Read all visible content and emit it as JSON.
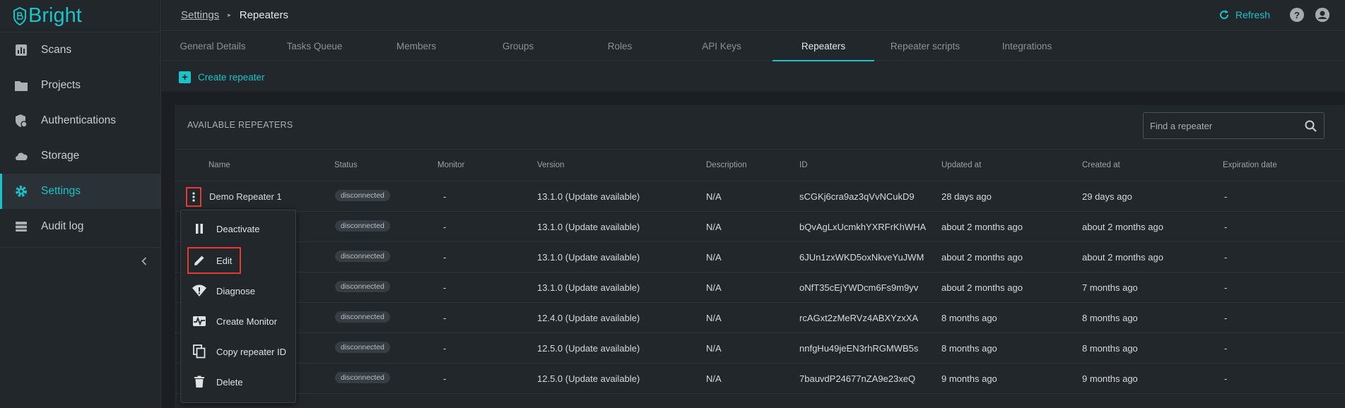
{
  "brand": {
    "name": "Bright",
    "color": "#19c3c8"
  },
  "sidebar": {
    "items": [
      {
        "label": "Scans",
        "icon": "scans-chart-icon"
      },
      {
        "label": "Projects",
        "icon": "folder-icon"
      },
      {
        "label": "Authentications",
        "icon": "shield-lock-icon"
      },
      {
        "label": "Storage",
        "icon": "cloud-icon"
      },
      {
        "label": "Settings",
        "icon": "gear-icon",
        "active": true
      },
      {
        "label": "Audit log",
        "icon": "audit-log-icon"
      }
    ]
  },
  "header": {
    "breadcrumb_parent": "Settings",
    "breadcrumb_current": "Repeaters",
    "refresh_label": "Refresh"
  },
  "tabs": [
    {
      "label": "General Details"
    },
    {
      "label": "Tasks Queue"
    },
    {
      "label": "Members"
    },
    {
      "label": "Groups"
    },
    {
      "label": "Roles"
    },
    {
      "label": "API Keys"
    },
    {
      "label": "Repeaters",
      "active": true
    },
    {
      "label": "Repeater scripts"
    },
    {
      "label": "Integrations"
    }
  ],
  "actions": {
    "create_label": "Create repeater"
  },
  "panel": {
    "title": "AVAILABLE REPEATERS",
    "search_placeholder": "Find a repeater"
  },
  "table": {
    "headers": [
      "Name",
      "Status",
      "Monitor",
      "Version",
      "Description",
      "ID",
      "Updated at",
      "Created at",
      "Expiration date"
    ],
    "rows": [
      {
        "name": "Demo Repeater 1",
        "status": "disconnected",
        "monitor": "-",
        "version": "13.1.0 (Update available)",
        "description": "N/A",
        "id": "sCGKj6cra9az3qVvNCukD9",
        "updated": "28 days ago",
        "created": "29 days ago",
        "expiration": "-"
      },
      {
        "name": "",
        "status": "disconnected",
        "monitor": "-",
        "version": "13.1.0 (Update available)",
        "description": "N/A",
        "id": "bQvAgLxUcmkhYXRFrKhWHA",
        "updated": "about 2 months ago",
        "created": "about 2 months ago",
        "expiration": "-"
      },
      {
        "name": "",
        "status": "disconnected",
        "monitor": "-",
        "version": "13.1.0 (Update available)",
        "description": "N/A",
        "id": "6JUn1zxWKD5oxNkveYuJWM",
        "updated": "about 2 months ago",
        "created": "about 2 months ago",
        "expiration": "-"
      },
      {
        "name": "",
        "status": "disconnected",
        "monitor": "-",
        "version": "13.1.0 (Update available)",
        "description": "N/A",
        "id": "oNfT35cEjYWDcm6Fs9m9yv",
        "updated": "about 2 months ago",
        "created": "7 months ago",
        "expiration": "-"
      },
      {
        "name": "",
        "status": "disconnected",
        "monitor": "-",
        "version": "12.4.0 (Update available)",
        "description": "N/A",
        "id": "rcAGxt2zMeRVz4ABXYzxXA",
        "updated": "8 months ago",
        "created": "8 months ago",
        "expiration": "-"
      },
      {
        "name": "",
        "status": "disconnected",
        "monitor": "-",
        "version": "12.5.0 (Update available)",
        "description": "N/A",
        "id": "nnfgHu49jeEN3rhRGMWB5s",
        "updated": "8 months ago",
        "created": "8 months ago",
        "expiration": "-"
      },
      {
        "name": "",
        "status": "disconnected",
        "monitor": "-",
        "version": "12.5.0 (Update available)",
        "description": "N/A",
        "id": "7bauvdP24677nZA9e23xeQ",
        "updated": "9 months ago",
        "created": "9 months ago",
        "expiration": "-"
      }
    ]
  },
  "context_menu": {
    "items": [
      {
        "label": "Deactivate",
        "icon": "pause-icon"
      },
      {
        "label": "Edit",
        "icon": "pencil-icon",
        "highlighted": true
      },
      {
        "label": "Diagnose",
        "icon": "wifi-alert-icon"
      },
      {
        "label": "Create Monitor",
        "icon": "monitor-pulse-icon"
      },
      {
        "label": "Copy repeater ID",
        "icon": "copy-icon"
      },
      {
        "label": "Delete",
        "icon": "trash-icon"
      }
    ]
  },
  "colors": {
    "accent": "#19c3c8",
    "highlight": "#e53935",
    "background": "#1b1f23",
    "surface": "#22272b"
  }
}
